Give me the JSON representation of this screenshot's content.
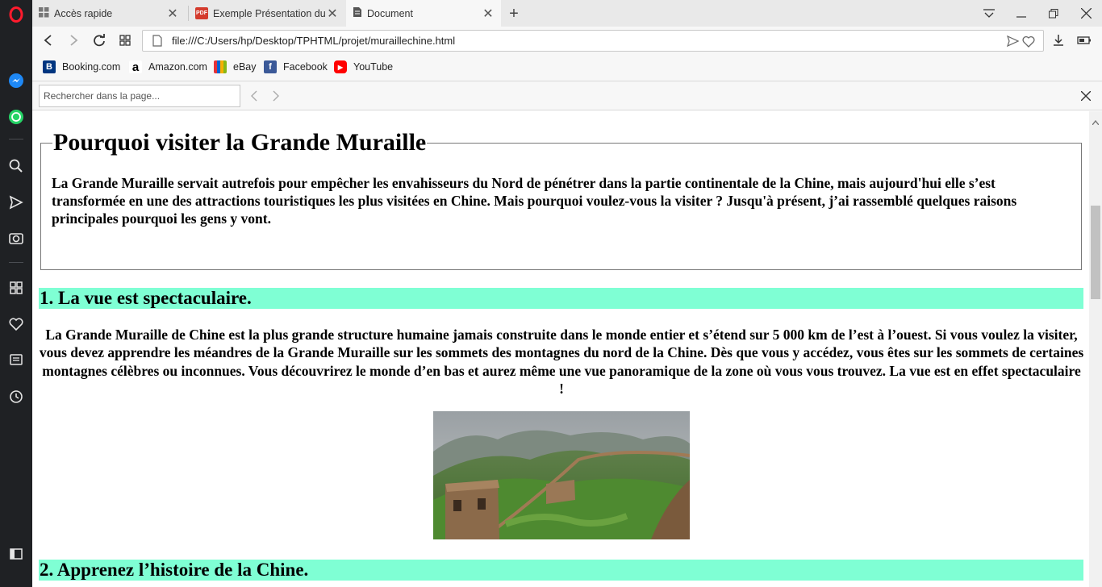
{
  "browser": {
    "tabs": [
      {
        "label": "Accès rapide",
        "icon": "speed-dial-icon"
      },
      {
        "label": "Exemple Présentation du p",
        "icon": "pdf-icon"
      },
      {
        "label": "Document",
        "icon": "document-icon"
      }
    ],
    "url": "file:///C:/Users/hp/Desktop/TPHTML/projet/muraillechine.html",
    "bookmarks": [
      {
        "label": "Booking.com",
        "icon": "booking-icon"
      },
      {
        "label": "Amazon.com",
        "icon": "amazon-icon"
      },
      {
        "label": "eBay",
        "icon": "ebay-icon"
      },
      {
        "label": "Facebook",
        "icon": "facebook-icon"
      },
      {
        "label": "YouTube",
        "icon": "youtube-icon"
      }
    ],
    "find": {
      "placeholder": "Rechercher dans la page..."
    },
    "sidebar_icons": [
      "opera-logo-icon",
      "messenger-icon",
      "whatsapp-icon",
      "search-icon",
      "send-icon",
      "camera-icon",
      "grid-icon",
      "heart-icon",
      "news-icon",
      "history-icon",
      "sidebar-toggle-icon"
    ]
  },
  "page": {
    "legend": "Pourquoi visiter la Grande Muraille",
    "intro": "La Grande Muraille servait autrefois pour empêcher les envahisseurs du Nord de pénétrer dans la partie continentale de la Chine, mais aujourd'hui elle s’est transformée en une des attractions touristiques les plus visitées en Chine. Mais pourquoi voulez-vous la visiter ? Jusqu'à présent, j’ai rassemblé quelques raisons principales pourquoi les gens y vont.",
    "section1_title": "1. La vue est spectaculaire.",
    "section1_text": "La Grande Muraille de Chine est la plus grande structure humaine jamais construite dans le monde entier et s’étend sur 5 000 km de l’est à l’ouest. Si vous voulez la visiter, vous devez apprendre les méandres de la Grande Muraille sur les sommets des montagnes du nord de la Chine. Dès que vous y accédez, vous êtes sur les sommets de certaines montagnes célèbres ou inconnues. Vous découvrirez le monde d’en bas et aurez même une vue panoramique de la zone où vous vous trouvez. La vue est en effet spectaculaire !",
    "section2_title": "2. Apprenez l’histoire de la Chine.",
    "heading_bg": "#7fffd4"
  }
}
